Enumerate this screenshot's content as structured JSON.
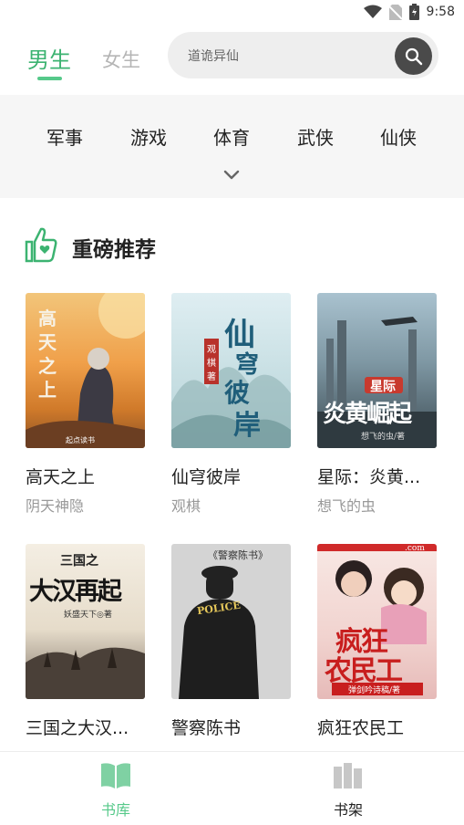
{
  "status": {
    "time": "9:58"
  },
  "header": {
    "tab_male": "男生",
    "tab_female": "女生",
    "search_placeholder": "道诡异仙"
  },
  "categories": [
    "军事",
    "游戏",
    "体育",
    "武侠",
    "仙侠"
  ],
  "section": {
    "title": "重磅推荐"
  },
  "books": [
    {
      "title": "高天之上",
      "author": "阴天神隐"
    },
    {
      "title": "仙穹彼岸",
      "author": "观棋"
    },
    {
      "title": "星际：炎黄...",
      "author": "想飞的虫"
    },
    {
      "title": "三国之大汉...",
      "author": ""
    },
    {
      "title": "警察陈书",
      "author": ""
    },
    {
      "title": "疯狂农民工",
      "author": ""
    }
  ],
  "covers": {
    "c1": [
      "高",
      "天",
      "之",
      "上",
      "起点读书"
    ],
    "c2": [
      "仙",
      "穹",
      "彼",
      "岸",
      "观",
      "棋",
      "著"
    ],
    "c3": [
      "星际",
      "炎黄崛起",
      "想飞的虫/著"
    ],
    "c4": [
      "三国之",
      "大汉再起",
      "妖盛天下◎著"
    ],
    "c5": [
      "《警察陈书》",
      "POLICE"
    ],
    "c6": [
      ".com",
      "疯狂",
      "农民工",
      "弹剑吟诗稿/著"
    ]
  },
  "bottom_nav": [
    {
      "label": "书库"
    },
    {
      "label": "书架"
    }
  ],
  "colors": {
    "accent": "#3cb371",
    "inactive": "#b5b5b5"
  }
}
